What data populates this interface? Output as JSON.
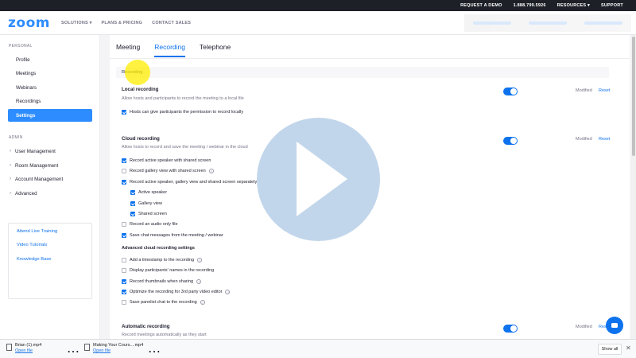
{
  "topbar": {
    "request_demo": "REQUEST A DEMO",
    "phone": "1.888.799.5926",
    "resources": "RESOURCES ▾",
    "support": "SUPPORT"
  },
  "navbar": {
    "logo": "zoom",
    "solutions": "SOLUTIONS ▾",
    "plans": "PLANS & PRICING",
    "contact": "CONTACT SALES"
  },
  "sidebar": {
    "personal_label": "PERSONAL",
    "personal_items": [
      "Profile",
      "Meetings",
      "Webinars",
      "Recordings",
      "Settings"
    ],
    "admin_label": "ADMIN",
    "admin_items": [
      "User Management",
      "Room Management",
      "Account Management",
      "Advanced"
    ],
    "links": [
      "Attend Live Training",
      "Video Tutorials",
      "Knowledge Base"
    ]
  },
  "tabs": [
    "Meeting",
    "Recording",
    "Telephone"
  ],
  "section_header": "Recording",
  "local_recording": {
    "title": "Local recording",
    "desc": "Allow hosts and participants to record the meeting to a local file",
    "option": "Hosts can give participants the permission to record locally",
    "modified": "Modified",
    "reset": "Reset"
  },
  "cloud_recording": {
    "title": "Cloud recording",
    "desc": "Allow hosts to record and save the meeting / webinar in the cloud",
    "modified": "Modified",
    "reset": "Reset",
    "options": [
      "Record active speaker with shared screen",
      "Record gallery view with shared screen",
      "Record active speaker, gallery view and shared screen separately",
      "Active speaker",
      "Gallery view",
      "Shared screen",
      "Record an audio only file",
      "Save chat messages from the meeting / webinar"
    ],
    "advanced_title": "Advanced cloud recording settings",
    "advanced_options": [
      "Add a timestamp to the recording",
      "Display participants' names in the recording",
      "Record thumbnails when sharing",
      "Optimize the recording for 3rd party video editor",
      "Save panelist chat to the recording"
    ]
  },
  "automatic_recording": {
    "title": "Automatic recording",
    "desc": "Record meetings automatically as they start",
    "modified": "Modified",
    "reset": "Reset"
  },
  "downloads": {
    "items": [
      {
        "name": "Brian (1).mp4",
        "action": "Open file"
      },
      {
        "name": "Making Your Cours....mp4",
        "action": "Open file"
      }
    ],
    "show_all": "Show all"
  }
}
